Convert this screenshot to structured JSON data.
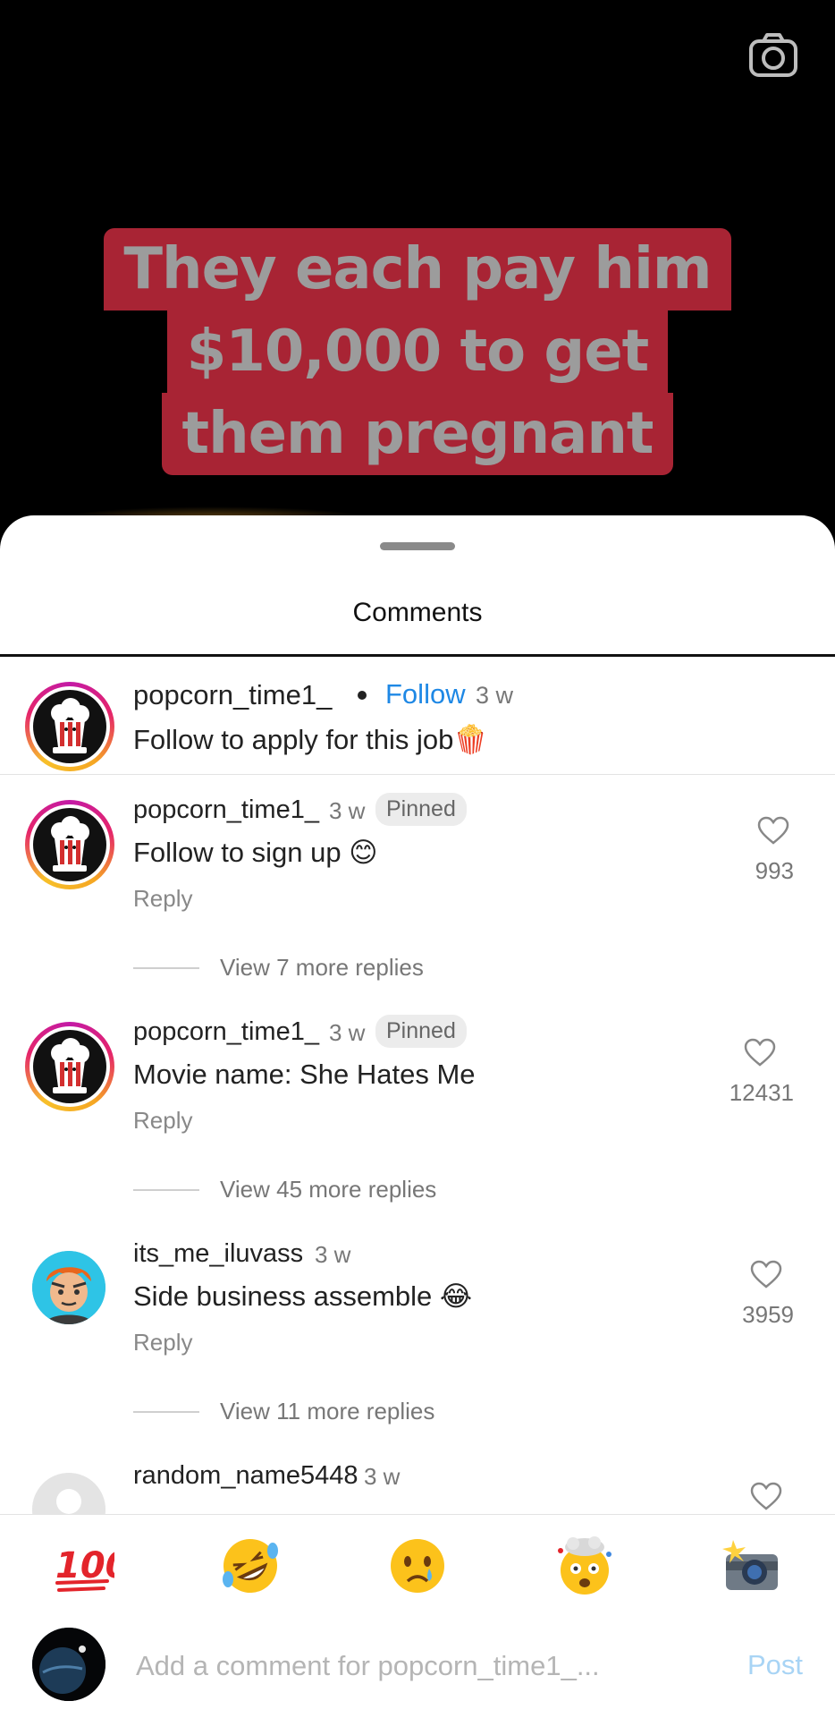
{
  "video": {
    "caption_lines": [
      "They each pay him",
      "$10,000 to get",
      "them pregnant"
    ],
    "camera_icon": "camera-icon"
  },
  "sheet": {
    "title": "Comments"
  },
  "caption_comment": {
    "username": "popcorn_time1_",
    "follow_label": "Follow",
    "time": "3 w",
    "text": "Follow to apply for this job🍿"
  },
  "comments": [
    {
      "username": "popcorn_time1_",
      "time": "3 w",
      "badge": "Pinned",
      "text": "Follow to sign up 😊",
      "reply_label": "Reply",
      "likes": "993",
      "view_more": "View 7 more replies"
    },
    {
      "username": "popcorn_time1_",
      "time": "3 w",
      "badge": "Pinned",
      "text": "Movie name: She Hates Me",
      "reply_label": "Reply",
      "likes": "12431",
      "view_more": "View 45 more replies"
    },
    {
      "username": "its_me_iluvass",
      "time": "3 w",
      "text": "Side business assemble 😂",
      "reply_label": "Reply",
      "likes": "3959",
      "view_more": "View 11 more replies"
    },
    {
      "username": "random_name5448",
      "time": "3 w"
    }
  ],
  "emoji_bar": [
    "💯",
    "🤣",
    "😢",
    "🤯",
    "📸"
  ],
  "compose": {
    "placeholder": "Add a comment for popcorn_time1_...",
    "post_label": "Post"
  },
  "colors": {
    "follow": "#1e88e5",
    "caption_bg": "#a82434",
    "post_disabled": "#a8d4f5"
  }
}
